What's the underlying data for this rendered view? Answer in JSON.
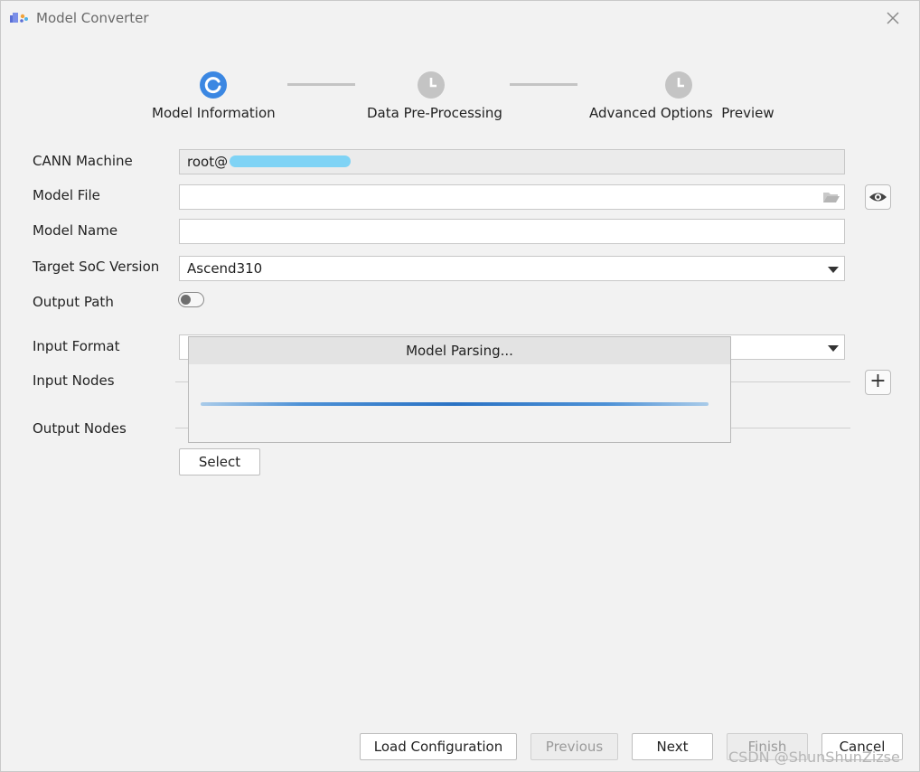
{
  "window": {
    "title": "Model Converter"
  },
  "steps": [
    {
      "label": "Model Information",
      "state": "active"
    },
    {
      "label": "Data Pre-Processing",
      "state": "pending"
    },
    {
      "label": "Advanced Options  Preview",
      "state": "pending"
    }
  ],
  "form": {
    "cann_machine": {
      "label": "CANN Machine",
      "value": "root@"
    },
    "model_file": {
      "label": "Model File",
      "value": ""
    },
    "model_name": {
      "label": "Model Name",
      "value": ""
    },
    "target_soc": {
      "label": "Target SoC Version",
      "value": "Ascend310"
    },
    "output_path": {
      "label": "Output Path",
      "enabled": false
    },
    "input_format": {
      "label": "Input Format",
      "value": ""
    },
    "input_nodes": {
      "label": "Input Nodes"
    },
    "output_nodes": {
      "label": "Output Nodes",
      "select_label": "Select"
    }
  },
  "modal": {
    "title": "Model Parsing...",
    "progress": "indeterminate"
  },
  "footer": {
    "load_config": "Load Configuration",
    "previous": "Previous",
    "next": "Next",
    "finish": "Finish",
    "cancel": "Cancel"
  },
  "watermark": "CSDN @ShunShunZizse",
  "colors": {
    "accent": "#3b87e2",
    "pending_step": "#c4c4c4",
    "progress": "#2b73c4"
  }
}
